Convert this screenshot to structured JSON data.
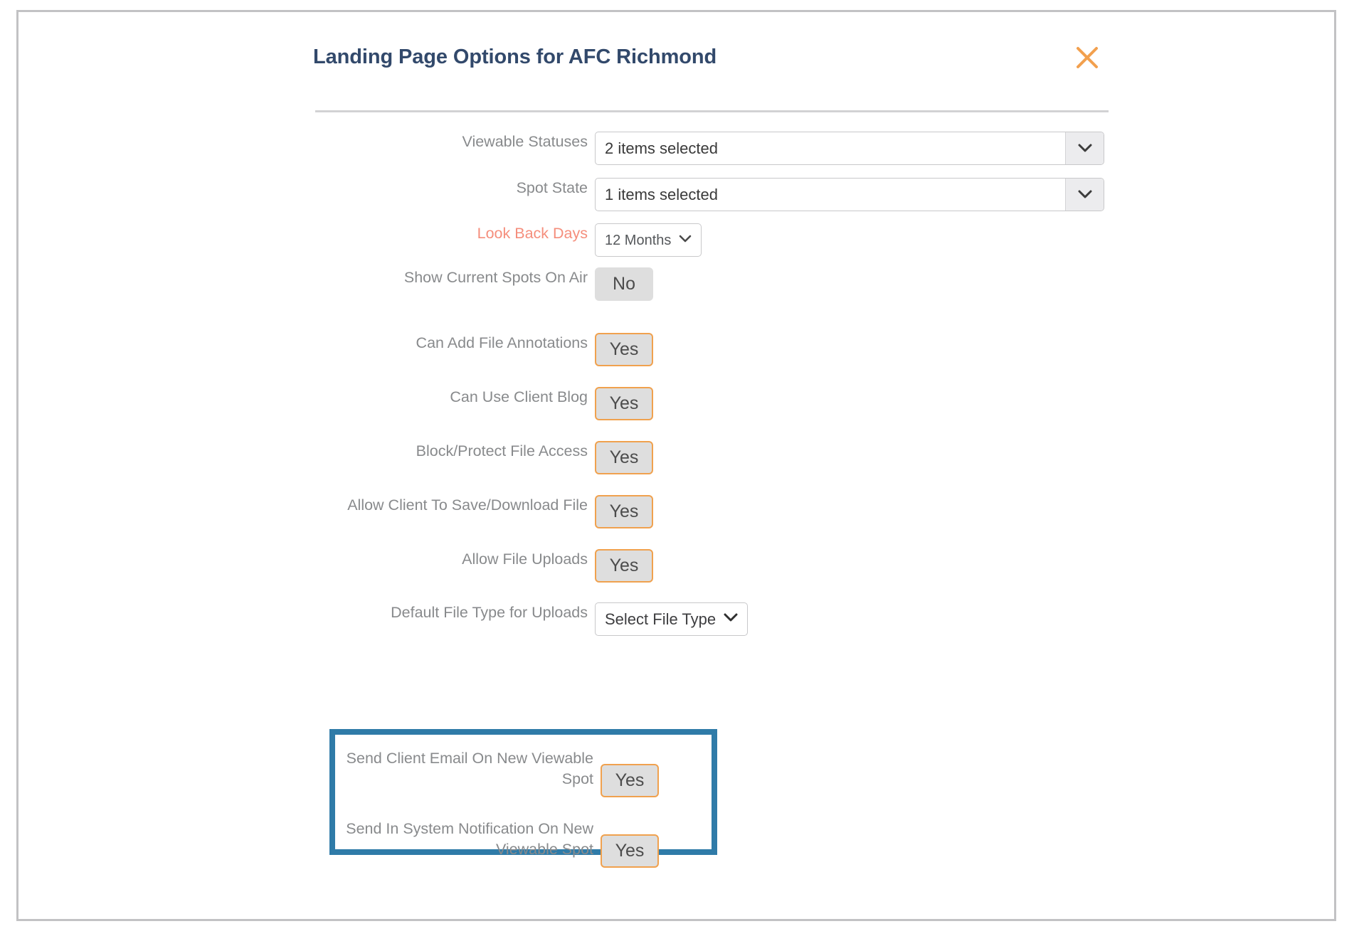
{
  "modal": {
    "title": "Landing Page Options for AFC Richmond",
    "close_icon": "close-x-icon",
    "accent_orange": "#f0a14e",
    "title_color": "#32496b",
    "highlight_border_color": "#2f7ba8",
    "accent_label_color": "#f58e7c"
  },
  "form": {
    "rows": [
      {
        "label": "Viewable Statuses",
        "control": "select-large",
        "value": "2 items selected",
        "name": "viewable-statuses"
      },
      {
        "label": "Spot State",
        "control": "select-large",
        "value": "1 items selected",
        "name": "spot-state"
      },
      {
        "label": "Look Back Days",
        "control": "select-small",
        "value": "12 Months",
        "name": "look-back-days",
        "label_accent": true
      },
      {
        "label": "Show Current Spots On Air",
        "control": "toggle",
        "value": "No",
        "state": "off",
        "name": "show-current-spots-on-air"
      },
      {
        "label": "Can Add File Annotations",
        "control": "toggle",
        "value": "Yes",
        "state": "on",
        "name": "can-add-file-annotations"
      },
      {
        "label": "Can Use Client Blog",
        "control": "toggle",
        "value": "Yes",
        "state": "on",
        "name": "can-use-client-blog"
      },
      {
        "label": "Block/Protect File Access",
        "control": "toggle",
        "value": "Yes",
        "state": "on",
        "name": "block-protect-file-access"
      },
      {
        "label": "Allow Client To Save/Download File",
        "control": "toggle",
        "value": "Yes",
        "state": "on",
        "name": "allow-client-to-save-download-file"
      },
      {
        "label": "Allow File Uploads",
        "control": "toggle",
        "value": "Yes",
        "state": "on",
        "name": "allow-file-uploads"
      },
      {
        "label": "Default File Type for Uploads",
        "control": "select-small-dark",
        "value": "Select File Type",
        "name": "default-file-type-for-uploads"
      }
    ],
    "highlighted_rows": [
      {
        "label_line1": "Send Client Email On New Viewable",
        "label_line2": "Spot",
        "control": "toggle",
        "value": "Yes",
        "state": "on",
        "name": "send-client-email-on-new-viewable-spot"
      },
      {
        "label_line1": "Send In System Notification On New",
        "label_line2": "Viewable Spot",
        "control": "toggle",
        "value": "Yes",
        "state": "on",
        "name": "send-in-system-notification-on-new-viewable-spot"
      }
    ]
  }
}
